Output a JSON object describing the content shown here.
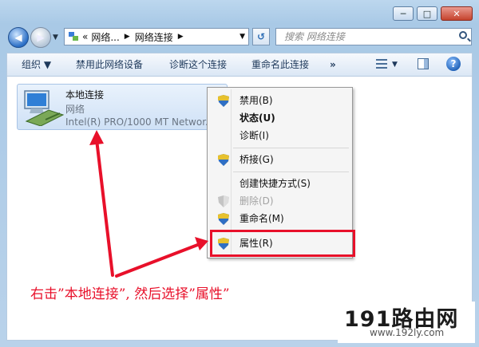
{
  "window": {
    "buttons": {
      "minimize": "─",
      "maximize": "□",
      "close": "✕"
    }
  },
  "address": {
    "prefix": "«",
    "crumbs": [
      "网络...",
      "网络连接"
    ],
    "sep": "▶",
    "dropdown": "▼"
  },
  "nav": {
    "back": "◀",
    "forward": "▶",
    "dropdown": "▼"
  },
  "refresh": "↺",
  "search": {
    "placeholder": "搜索 网络连接"
  },
  "toolbar": {
    "organize": "组织 ▼",
    "disable": "禁用此网络设备",
    "diagnose": "诊断这个连接",
    "rename": "重命名此连接",
    "more": "»",
    "views_dropdown": "▼",
    "help": "?"
  },
  "connection": {
    "name": "本地连接",
    "type": "网络",
    "device": "Intel(R) PRO/1000 MT Networ..."
  },
  "menu": {
    "items": [
      {
        "label": "禁用(B)",
        "shield": true
      },
      {
        "label": "状态(U)",
        "bold": true
      },
      {
        "label": "诊断(I)"
      },
      {
        "label": "桥接(G)",
        "shield": true
      },
      {
        "label": "创建快捷方式(S)"
      },
      {
        "label": "删除(D)",
        "shield": true,
        "disabled": true
      },
      {
        "label": "重命名(M)",
        "shield": true
      },
      {
        "label": "属性(R)",
        "shield": true,
        "highlighted": true
      }
    ]
  },
  "annotation": "右击”本地连接”, 然后选择”属性”",
  "watermark": {
    "main": "191路由网",
    "sub": "www.192ly.com"
  },
  "colors": {
    "annotation_red": "#e8102a",
    "selection_blue": "#cfe1f6"
  }
}
